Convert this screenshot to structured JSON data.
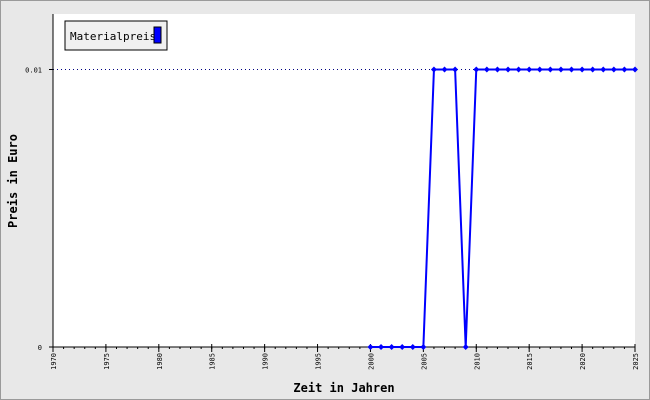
{
  "chart_data": {
    "type": "line",
    "title": "",
    "xlabel": "Zeit in Jahren",
    "ylabel": "Preis in Euro",
    "xlim": [
      1970,
      2025
    ],
    "ylim": [
      0,
      0.012
    ],
    "x_ticks": [
      1970,
      1975,
      1980,
      1985,
      1990,
      1995,
      2000,
      2005,
      2010,
      2015,
      2020,
      2025
    ],
    "y_ticks": [
      {
        "value": 0,
        "label": "0"
      },
      {
        "value": 0.01,
        "label": "0.01"
      }
    ],
    "legend_position": "top-left",
    "series": [
      {
        "name": "Materialpreis",
        "color": "#0000ff",
        "x": [
          2000,
          2001,
          2002,
          2003,
          2004,
          2005,
          2006,
          2007,
          2008,
          2009,
          2010,
          2011,
          2012,
          2013,
          2014,
          2015,
          2016,
          2017,
          2018,
          2019,
          2020,
          2021,
          2022,
          2023,
          2024,
          2025
        ],
        "values": [
          0,
          0,
          0,
          0,
          0,
          0,
          0.01,
          0.01,
          0.01,
          0,
          0.01,
          0.01,
          0.01,
          0.01,
          0.01,
          0.01,
          0.01,
          0.01,
          0.01,
          0.01,
          0.01,
          0.01,
          0.01,
          0.01,
          0.01,
          0.01
        ]
      }
    ],
    "reference_line": {
      "value": 0.01,
      "style": "dotted",
      "color": "#000080"
    }
  }
}
